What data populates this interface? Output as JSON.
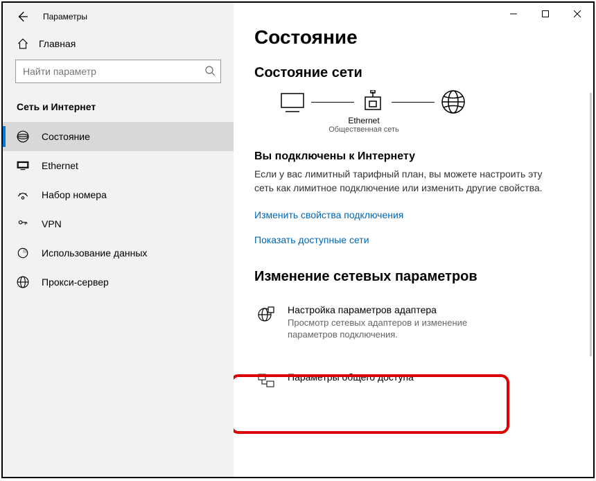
{
  "titlebar": {
    "title": "Параметры"
  },
  "sidebar": {
    "home": "Главная",
    "search_placeholder": "Найти параметр",
    "section": "Сеть и Интернет",
    "items": [
      {
        "label": "Состояние"
      },
      {
        "label": "Ethernet"
      },
      {
        "label": "Набор номера"
      },
      {
        "label": "VPN"
      },
      {
        "label": "Использование данных"
      },
      {
        "label": "Прокси-сервер"
      }
    ]
  },
  "main": {
    "h1": "Состояние",
    "net_status_h": "Состояние сети",
    "diagram": {
      "conn_name": "Ethernet",
      "conn_type": "Общественная сеть"
    },
    "connected_h": "Вы подключены к Интернету",
    "connected_desc": "Если у вас лимитный тарифный план, вы можете настроить эту сеть как лимитное подключение или изменить другие свойства.",
    "link_props": "Изменить свойства подключения",
    "link_nets": "Показать доступные сети",
    "change_h": "Изменение сетевых параметров",
    "adapter": {
      "title": "Настройка параметров адаптера",
      "desc": "Просмотр сетевых адаптеров и изменение параметров подключения."
    },
    "sharing": {
      "title": "Параметры общего доступа"
    }
  }
}
